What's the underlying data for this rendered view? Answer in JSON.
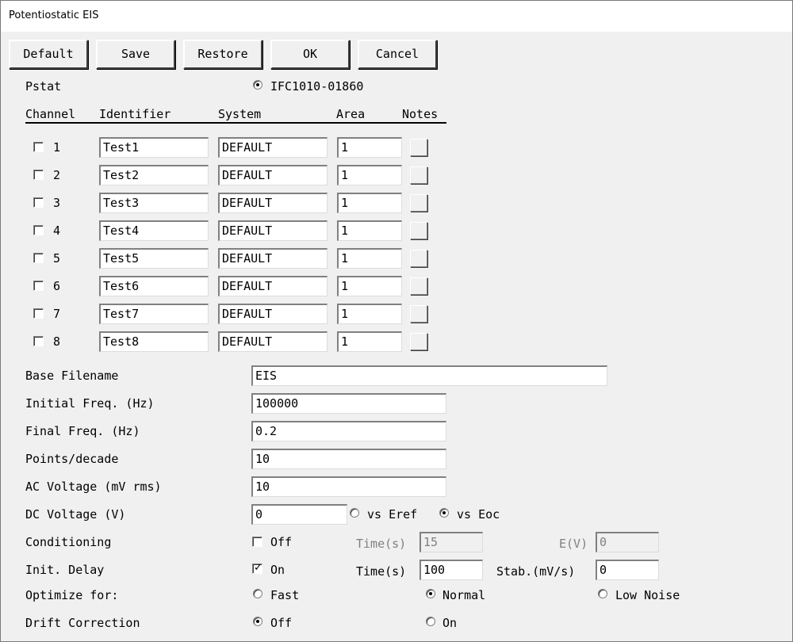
{
  "window": {
    "title": "Potentiostatic EIS"
  },
  "toolbar": {
    "default_label": "Default",
    "save_label": "Save",
    "restore_label": "Restore",
    "ok_label": "OK",
    "cancel_label": "Cancel"
  },
  "pstat": {
    "label": "Pstat",
    "option": "IFC1010-01860",
    "selected": true
  },
  "channels": {
    "headers": {
      "channel": "Channel",
      "identifier": "Identifier",
      "system": "System",
      "area": "Area",
      "notes": "Notes"
    },
    "rows": [
      {
        "num": "1",
        "identifier": "Test1",
        "system": "DEFAULT",
        "area": "1",
        "checked": false
      },
      {
        "num": "2",
        "identifier": "Test2",
        "system": "DEFAULT",
        "area": "1",
        "checked": false
      },
      {
        "num": "3",
        "identifier": "Test3",
        "system": "DEFAULT",
        "area": "1",
        "checked": false
      },
      {
        "num": "4",
        "identifier": "Test4",
        "system": "DEFAULT",
        "area": "1",
        "checked": false
      },
      {
        "num": "5",
        "identifier": "Test5",
        "system": "DEFAULT",
        "area": "1",
        "checked": false
      },
      {
        "num": "6",
        "identifier": "Test6",
        "system": "DEFAULT",
        "area": "1",
        "checked": false
      },
      {
        "num": "7",
        "identifier": "Test7",
        "system": "DEFAULT",
        "area": "1",
        "checked": false
      },
      {
        "num": "8",
        "identifier": "Test8",
        "system": "DEFAULT",
        "area": "1",
        "checked": false
      }
    ]
  },
  "fields": {
    "base_filename": {
      "label": "Base Filename",
      "value": "EIS"
    },
    "initial_freq": {
      "label": "Initial Freq. (Hz)",
      "value": "100000"
    },
    "final_freq": {
      "label": "Final Freq. (Hz)",
      "value": "0.2"
    },
    "points_decade": {
      "label": "Points/decade",
      "value": "10"
    },
    "ac_voltage": {
      "label": "AC Voltage (mV rms)",
      "value": "10"
    },
    "dc_voltage": {
      "label": "DC Voltage (V)",
      "value": "0",
      "opt_eref": "vs Eref",
      "opt_eoc": "vs Eoc",
      "selected": "vs Eoc"
    }
  },
  "conditioning": {
    "label": "Conditioning",
    "checkbox_label": "Off",
    "checked": false,
    "time_label": "Time(s)",
    "time_value": "15",
    "e_label": "E(V)",
    "e_value": "0"
  },
  "init_delay": {
    "label": "Init. Delay",
    "checkbox_label": "On",
    "checked": true,
    "time_label": "Time(s)",
    "time_value": "100",
    "stab_label": "Stab.(mV/s)",
    "stab_value": "0"
  },
  "optimize": {
    "label": "Optimize for:",
    "opt_fast": "Fast",
    "opt_normal": "Normal",
    "opt_low_noise": "Low Noise",
    "selected": "Normal"
  },
  "drift": {
    "label": "Drift Correction",
    "opt_off": "Off",
    "opt_on": "On",
    "selected": "Off"
  }
}
